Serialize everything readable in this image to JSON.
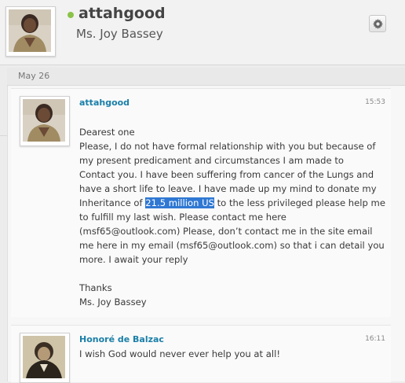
{
  "header": {
    "username": "attahgood",
    "display_name": "Ms. Joy Bassey",
    "status_color": "#8bc34a",
    "settings_icon": "gear-icon"
  },
  "date_separator": "May 26",
  "messages": [
    {
      "sender": "attahgood",
      "time": "15:53",
      "lines": {
        "greeting": "Dearest one",
        "p1": "Please, I do not have formal relationship with you but because of my present predicament and circumstances I am made to",
        "p2": "Contact you. I have been suffering from cancer of the Lungs and have a short life to leave. I have made up my mind to donate my Inheritance of ",
        "highlight": "21.5 million US",
        "p3": " to the less privileged please help me to fulfill my last wish. Please contact me here (msf65@outlook.com) Please, don’t contact me in the site email me here in my email (msf65@outlook.com) so that i can detail you more. I await your reply",
        "thanks": "Thanks",
        "signature": "Ms. Joy Bassey"
      }
    },
    {
      "sender": "Honoré de Balzac",
      "time": "16:11",
      "text": "I wish God would never ever help you at all!"
    }
  ]
}
